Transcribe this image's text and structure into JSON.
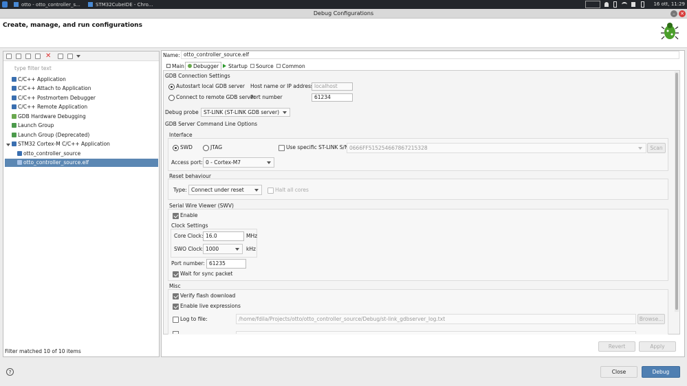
{
  "taskbar": {
    "tasks": [
      "otto - otto_controller_s...",
      "STM32CubeIDE - Chro..."
    ],
    "clock": "16 ott, 11:29"
  },
  "window": {
    "title": "Debug Configurations"
  },
  "header": {
    "title": "Create, manage, and run configurations"
  },
  "left": {
    "filter_placeholder": "type filter text",
    "tree": [
      {
        "label": "C/C++ Application",
        "color": "#3a6fb0"
      },
      {
        "label": "C/C++ Attach to Application",
        "color": "#3a6fb0"
      },
      {
        "label": "C/C++ Postmortem Debugger",
        "color": "#3a6fb0"
      },
      {
        "label": "C/C++ Remote Application",
        "color": "#3a6fb0"
      },
      {
        "label": "GDB Hardware Debugging",
        "color": "#6aa84f"
      },
      {
        "label": "Launch Group",
        "color": "#4c9a4c"
      },
      {
        "label": "Launch Group (Deprecated)",
        "color": "#4c9a4c"
      },
      {
        "label": "STM32 Cortex-M C/C++ Application",
        "color": "#3a6fb0"
      },
      {
        "label": "otto_controller_source",
        "color": "#3a6fb0"
      },
      {
        "label": "otto_controller_source.elf",
        "color": "#3a6fb0"
      }
    ],
    "status": "Filter matched 10 of 10 items"
  },
  "right": {
    "name_label": "Name:",
    "name_value": "otto_controller_source.elf",
    "tabs": [
      "Main",
      "Debugger",
      "Startup",
      "Source",
      "Common"
    ],
    "gdb_connection": {
      "title": "GDB Connection Settings",
      "autostart": "Autostart local GDB server",
      "host_label": "Host name or IP address",
      "host_value": "localhost",
      "remote": "Connect to remote GDB server",
      "port_label": "Port number",
      "port_value": "61234"
    },
    "probe": {
      "label": "Debug probe",
      "value": "ST-LINK (ST-LINK GDB server)"
    },
    "cmdline_title": "GDB Server Command Line Options",
    "interface": {
      "title": "Interface",
      "swd": "SWD",
      "jtag": "JTAG",
      "use_sn": "Use specific ST-LINK S/N",
      "sn_value": "0666FF515254667867215328",
      "scan": "Scan",
      "access_port_label": "Access port:",
      "access_port_value": "0 - Cortex-M7"
    },
    "reset": {
      "title": "Reset behaviour",
      "type_label": "Type:",
      "type_value": "Connect under reset",
      "halt": "Halt all cores"
    },
    "swv": {
      "title": "Serial Wire Viewer (SWV)",
      "enable": "Enable",
      "clock_title": "Clock Settings",
      "core_label": "Core Clock:",
      "core_value": "16.0",
      "core_unit": "MHz",
      "swo_label": "SWO Clock:",
      "swo_value": "1000",
      "swo_unit": "kHz",
      "port_label": "Port number:",
      "port_value": "61235",
      "sync": "Wait for sync packet"
    },
    "misc": {
      "title": "Misc",
      "verify": "Verify flash download",
      "live": "Enable live expressions",
      "log": "Log to file:",
      "log_path": "/home/fdila/Projects/otto/otto_controller_source/Debug/st-link_gdbserver_log.txt",
      "browse": "Browse..."
    },
    "revert": "Revert",
    "apply": "Apply"
  },
  "footer": {
    "help": "?",
    "close": "Close",
    "debug": "Debug"
  }
}
